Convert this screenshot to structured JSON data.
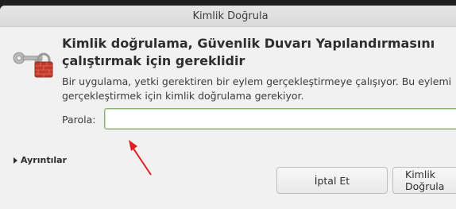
{
  "window": {
    "title": "Kimlik Doğrula"
  },
  "dialog": {
    "heading": "Kimlik doğrulama, Güvenlik Duvarı Yapılandırmasını çalıştırmak için gereklidir",
    "description": "Bir uygulama, yetki gerektiren bir eylem gerçekleştirmeye çalışıyor. Bu eylemi gerçekleştirmek için kimlik doğrulama gerekiyor.",
    "icon": "lock-key-icon",
    "password": {
      "label": "Parola:",
      "value": "",
      "placeholder": ""
    },
    "details_label": "Ayrıntılar",
    "buttons": {
      "cancel": "İptal Et",
      "authenticate": "Kimlik Doğrula"
    }
  },
  "annotation": {
    "icon": "red-arrow",
    "color": "#e02020"
  },
  "colors": {
    "dialog_bg": "#f1f1f1",
    "focus_border": "#8fb07a",
    "lock_red": "#c0392b"
  }
}
